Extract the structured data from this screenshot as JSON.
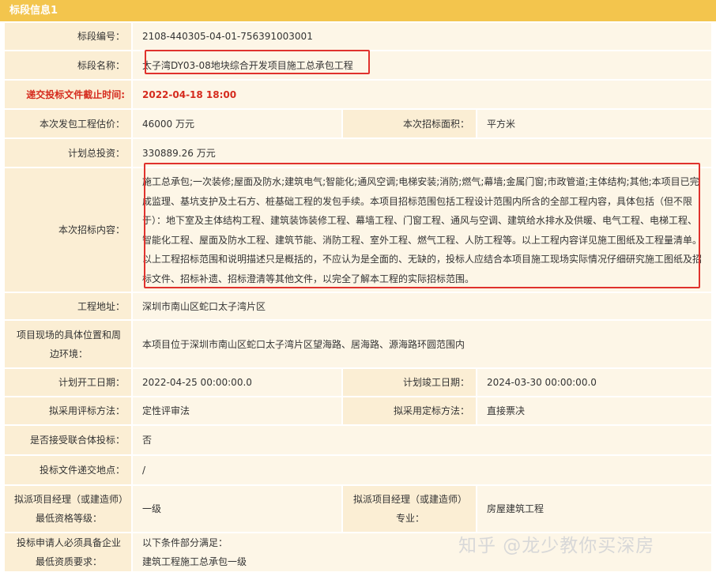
{
  "header": {
    "title": "标段信息1"
  },
  "rows": {
    "code": {
      "label": "标段编号：",
      "value": "2108-440305-04-01-756391003001"
    },
    "name": {
      "label": "标段名称：",
      "value": "太子湾DY03-08地块综合开发项目施工总承包工程"
    },
    "deadline": {
      "label": "递交投标文件截止时间:",
      "value": "2022-04-18 18:00"
    },
    "estimate": {
      "label": "本次发包工程估价：",
      "value": "46000 万元",
      "label2": "本次招标面积：",
      "value2": "平方米"
    },
    "investment": {
      "label": "计划总投资：",
      "value": "330889.26 万元"
    },
    "content": {
      "label": "本次招标内容：",
      "value": "施工总承包;一次装修;屋面及防水;建筑电气;智能化;通风空调;电梯安装;消防;燃气;幕墙;金属门窗;市政管道;主体结构;其他;本项目已完成监理、基坑支护及土石方、桩基础工程的发包手续。本项目招标范围包括工程设计范围内所含的全部工程内容，具体包括（但不限于）：地下室及主体结构工程、建筑装饰装修工程、幕墙工程、门窗工程、通风与空调、建筑给水排水及供暖、电气工程、电梯工程、智能化工程、屋面及防水工程、建筑节能、消防工程、室外工程、燃气工程、人防工程等。以上工程内容详见施工图纸及工程量清单。 以上工程招标范围和说明描述只是概括的，不应认为是全面的、无缺的，投标人应结合本项目施工现场实际情况仔细研究施工图纸及招标文件、招标补遗、招标澄清等其他文件，以完全了解本工程的实际招标范围。"
    },
    "address": {
      "label": "工程地址：",
      "value": "深圳市南山区蛇口太子湾片区"
    },
    "location": {
      "label": "项目现场的具体位置和周边环境：",
      "value": "本项目位于深圳市南山区蛇口太子湾片区望海路、居海路、源海路环圆范围内"
    },
    "start": {
      "label": "计划开工日期：",
      "value": "2022-04-25 00:00:00.0",
      "label2": "计划竣工日期：",
      "value2": "2024-03-30 00:00:00.0"
    },
    "evaluation": {
      "label": "拟采用评标方法：",
      "value": "定性评审法",
      "label2": "拟采用定标方法：",
      "value2": "直接票决"
    },
    "consortium": {
      "label": "是否接受联合体投标：",
      "value": "否"
    },
    "submit_place": {
      "label": "投标文件递交地点：",
      "value": "/"
    },
    "manager": {
      "label": "拟派项目经理（或建造师）最低资格等级：",
      "value": "一级",
      "label2": "拟派项目经理（或建造师）专业：",
      "value2": "房屋建筑工程"
    },
    "qualification": {
      "label": "投标申请人必须具备企业最低资质要求：",
      "value_line1": "以下条件部分满足：",
      "value_line2": "建筑工程施工总承包一级"
    }
  },
  "watermark": "知乎 @龙少教你买深房"
}
